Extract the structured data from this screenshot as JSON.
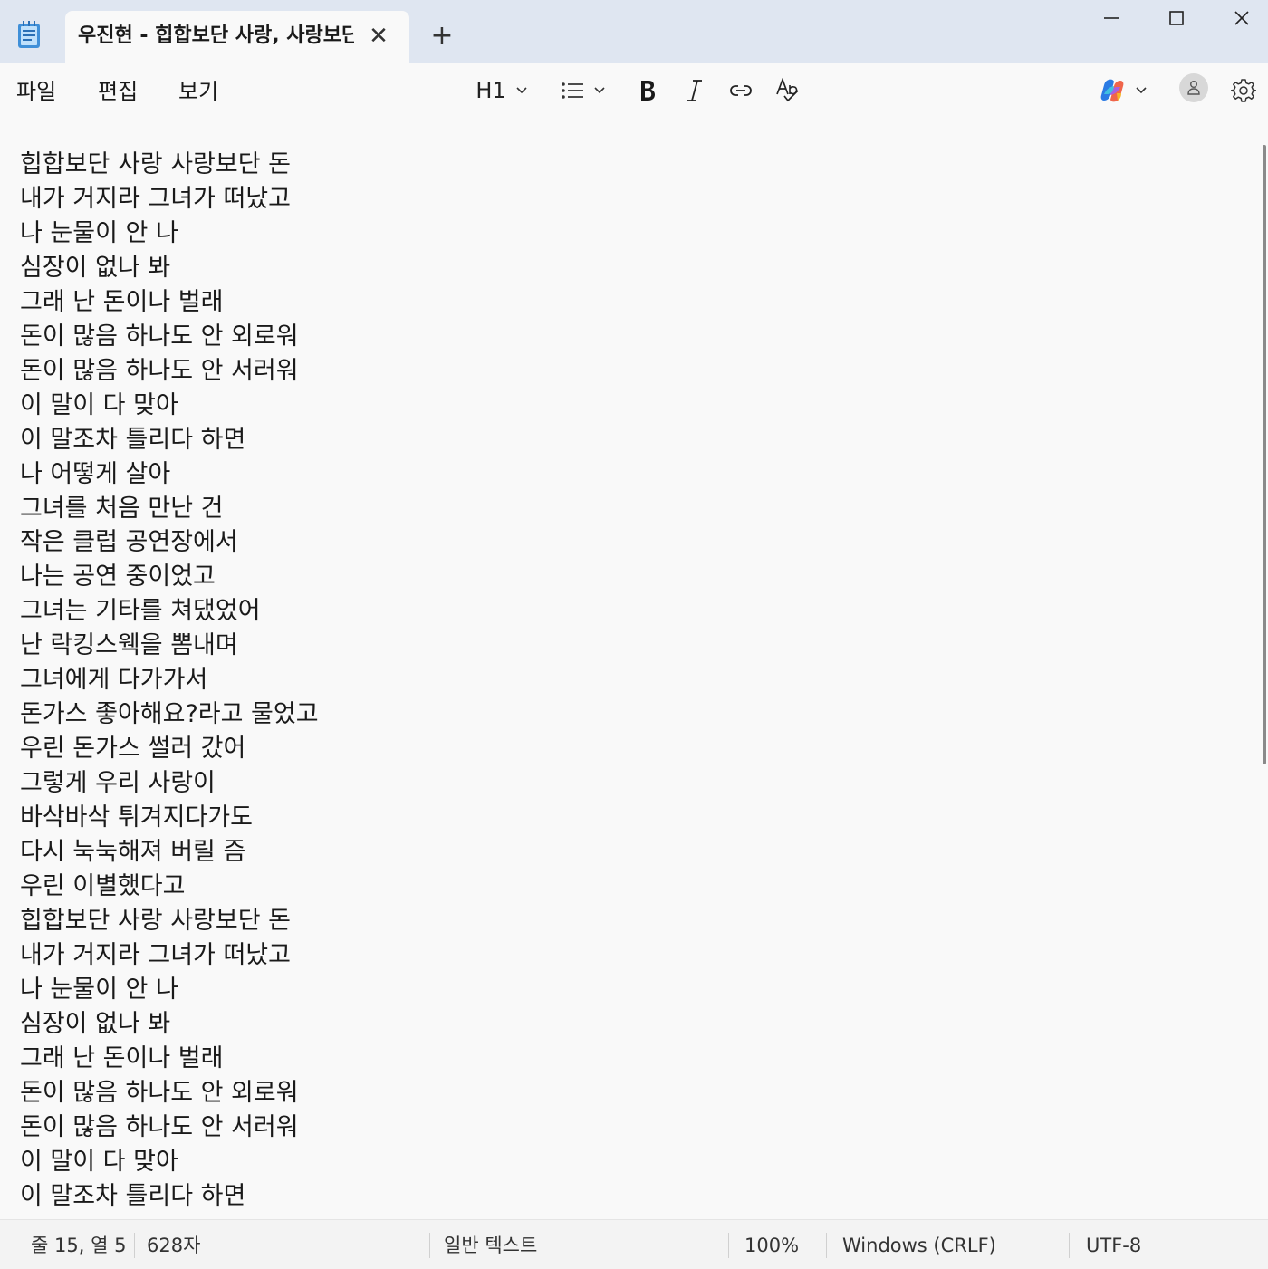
{
  "tab": {
    "title": "우진현 - 힙합보단 사랑, 사랑보단 돈"
  },
  "menu": {
    "file": "파일",
    "edit": "편집",
    "view": "보기"
  },
  "toolbar": {
    "heading_label": "H1"
  },
  "editor": {
    "lines": [
      "힙합보단 사랑 사랑보단 돈",
      "내가 거지라 그녀가 떠났고",
      "나 눈물이 안 나",
      "심장이 없나 봐",
      "그래 난 돈이나 벌래",
      "돈이 많음 하나도 안 외로워",
      "돈이 많음 하나도 안 서러워",
      "이 말이 다 맞아",
      "이 말조차 틀리다 하면",
      "나 어떻게 살아",
      "그녀를 처음 만난 건",
      "작은 클럽 공연장에서",
      "나는 공연 중이었고",
      "그녀는 기타를 쳐댔었어",
      "난 락킹스웩을 뽐내며",
      "그녀에게 다가가서",
      "돈가스 좋아해요?라고 물었고",
      "우린 돈가스 썰러 갔어",
      "그렇게 우리 사랑이",
      "바삭바삭 튀겨지다가도",
      "다시 눅눅해져 버릴 즘",
      "우린 이별했다고",
      "힙합보단 사랑 사랑보단 돈",
      "내가 거지라 그녀가 떠났고",
      "나 눈물이 안 나",
      "심장이 없나 봐",
      "그래 난 돈이나 벌래",
      "돈이 많음 하나도 안 외로워",
      "돈이 많음 하나도 안 서러워",
      "이 말이 다 맞아",
      "이 말조차 틀리다 하면"
    ]
  },
  "status": {
    "position": "줄 15, 열 5",
    "char_count": "628자",
    "format": "일반 텍스트",
    "zoom": "100%",
    "line_ending": "Windows (CRLF)",
    "encoding": "UTF-8"
  },
  "icons": {
    "app": "notepad-icon",
    "copilot": "copilot-icon"
  },
  "colors": {
    "titlebar": "#dfe6f1",
    "background": "#f9f9f9"
  }
}
